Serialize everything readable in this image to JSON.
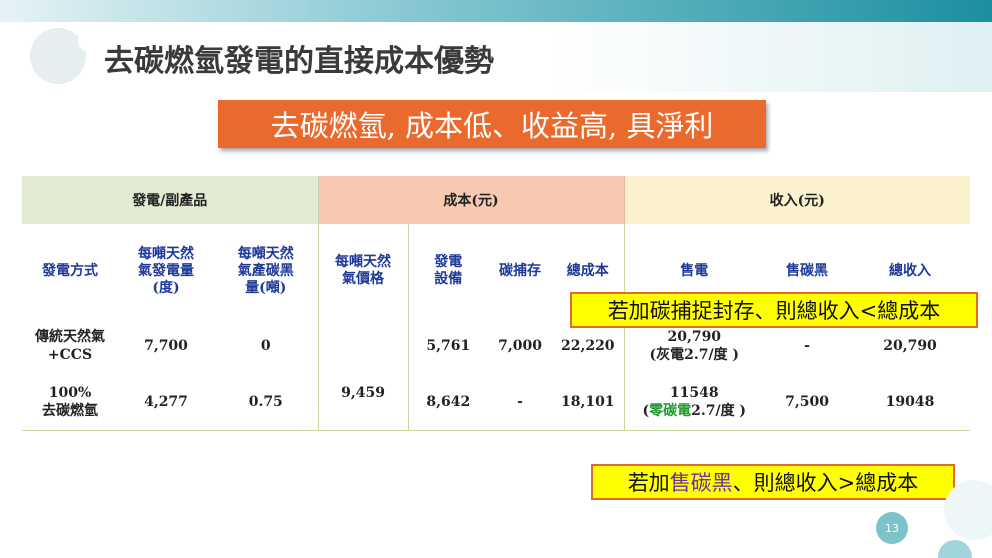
{
  "slide": {
    "title": "去碳燃氫發電的直接成本優勢",
    "banner": "去碳燃氫, 成本低、收益高, 具淨利",
    "page_number": "13"
  },
  "table": {
    "groups": [
      "發電/副產品",
      "成本(元)",
      "收入(元)"
    ],
    "subheaders": {
      "method": "發電方式",
      "gen": [
        "每噸天然",
        "氣發電量",
        "(度)"
      ],
      "carbon": [
        "每噸天然",
        "氣產碳黑",
        "量(噸)"
      ],
      "price": [
        "每噸天然",
        "氣價格"
      ],
      "equip": [
        "發電",
        "設備"
      ],
      "capture": "碳捕存",
      "total_cost": "總成本",
      "sell_power": "售電",
      "sell_carbon": "售碳黑",
      "total_rev": "總收入"
    },
    "shared_price": "9,459",
    "rows": [
      {
        "method": [
          "傳統天然氣",
          "+CCS"
        ],
        "gen": "7,700",
        "carbon": "0",
        "equip": "5,761",
        "capture": "7,000",
        "total_cost": "22,220",
        "sell_power": [
          "20,790",
          "(灰電2.7/度 )"
        ],
        "sell_carbon": "-",
        "total_rev": "20,790"
      },
      {
        "method": [
          "100%",
          "去碳燃氫"
        ],
        "gen": "4,277",
        "carbon": "0.75",
        "equip": "8,642",
        "capture": "-",
        "total_cost": "18,101",
        "sell_power_value": "11548",
        "sell_power_note_pre": "(",
        "sell_power_note_green": "零碳電",
        "sell_power_note_post": "2.7/度 )",
        "sell_carbon": "7,500",
        "total_rev": "19048"
      }
    ]
  },
  "callouts": {
    "ccs": "若加碳捕捉封存、則總收入<總成本",
    "carbon_pre": "若加",
    "carbon_hl": "售碳黑",
    "carbon_post": "、則總收入>總成本"
  }
}
